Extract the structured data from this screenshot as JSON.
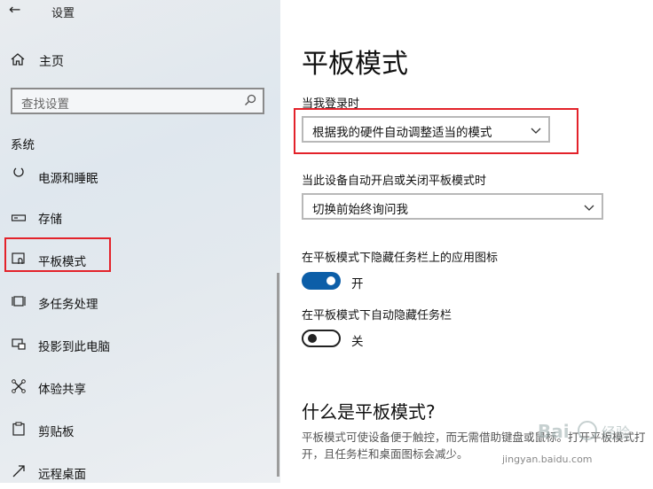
{
  "window": {
    "title": "设置",
    "back_glyph": "←"
  },
  "sidebar": {
    "home_label": "主页",
    "search_placeholder": "查找设置",
    "section_label": "系统",
    "items": [
      {
        "label": "电源和睡眠",
        "icon": "power-icon"
      },
      {
        "label": "存储",
        "icon": "storage-icon"
      },
      {
        "label": "平板模式",
        "icon": "tablet-mode-icon",
        "selected": true
      },
      {
        "label": "多任务处理",
        "icon": "multitasking-icon"
      },
      {
        "label": "投影到此电脑",
        "icon": "project-icon"
      },
      {
        "label": "体验共享",
        "icon": "share-icon"
      },
      {
        "label": "剪贴板",
        "icon": "clipboard-icon"
      },
      {
        "label": "远程桌面",
        "icon": "remote-desktop-icon"
      }
    ]
  },
  "main": {
    "title": "平板模式",
    "signin_label": "当我登录时",
    "signin_value": "根据我的硬件自动调整适当的模式",
    "auto_switch_label": "当此设备自动开启或关闭平板模式时",
    "auto_switch_value": "切换前始终询问我",
    "hide_icons_label": "在平板模式下隐藏任务栏上的应用图标",
    "hide_icons_state": "开",
    "autohide_label": "在平板模式下自动隐藏任务栏",
    "autohide_state": "关",
    "what_title": "什么是平板模式?",
    "what_desc": "平板模式可使设备便于触控，而无需借助键盘或鼠标。打开平板模式打开，且任务栏和桌面图标会减少。"
  },
  "watermark": {
    "text": "jingyan.baidu.com"
  },
  "colors": {
    "accent": "#0c5ea8",
    "highlight_box": "#e3222a"
  }
}
